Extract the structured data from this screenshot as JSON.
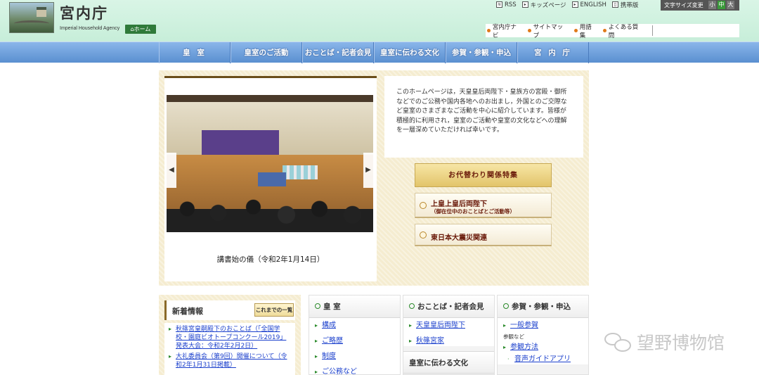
{
  "header": {
    "site_title": "宮内庁",
    "site_subtitle": "Imperial Household Agency",
    "home_label": "ホーム",
    "top_links": [
      "RSS",
      "キッズページ",
      "ENGLISH",
      "携帯版"
    ],
    "text_size_label": "文字サイズ変更",
    "text_sizes": [
      "小",
      "中",
      "大"
    ],
    "sub_links": [
      "宮内庁ナビ",
      "サイトマップ",
      "用語集",
      "よくある質問"
    ],
    "search_placeholder": ""
  },
  "nav": {
    "items": [
      "皇 室",
      "皇室のご活動",
      "おことば・記者会見",
      "皇室に伝わる文化",
      "参賀・参観・申込",
      "宮 内 庁"
    ]
  },
  "hero": {
    "caption": "講書始の儀（令和2年1月14日）",
    "intro": "このホームページは，天皇皇后両陛下・皇族方の宮殿・御所などでのご公務や国内各地へのお出まし，外国とのご交際など皇室のさまざまなご活動を中心に紹介しています。皆様が積極的に利用され，皇室のご活動や皇室の文化などへの理解を一層深めていただければ幸いです。",
    "banners": {
      "b1": "お代替わり関係特集",
      "b2_title": "上皇上皇后両陛下",
      "b2_sub": "（御在位中のおことばとご活動等）",
      "b3": "東日本大震災関連"
    }
  },
  "news": {
    "title": "新着情報",
    "all_label": "これまでの一覧",
    "items": [
      "秋篠宮皇嗣殿下のおことば（「全国学校・園庭ビオトープコンクール2019」発表大会：令和2年2月2日）",
      "大礼委員会（第9回）開催について（令和2年1月31日掲載）"
    ]
  },
  "columns": {
    "imperial": {
      "head": "皇 室",
      "links": [
        "構成",
        "ご略歴",
        "制度",
        "ご公務など"
      ]
    },
    "remarks": {
      "head": "おことば・記者会見",
      "links": [
        "天皇皇后両陛下",
        "秋篠宮家"
      ],
      "head2": "皇室に伝わる文化"
    },
    "visits": {
      "head": "参賀・参観・申込",
      "links": [
        "一般参賀"
      ],
      "sublabel": "参観など",
      "link2": "参観方法",
      "sublink": "音声ガイドアプリ"
    }
  },
  "watermark": "望野博物馆"
}
